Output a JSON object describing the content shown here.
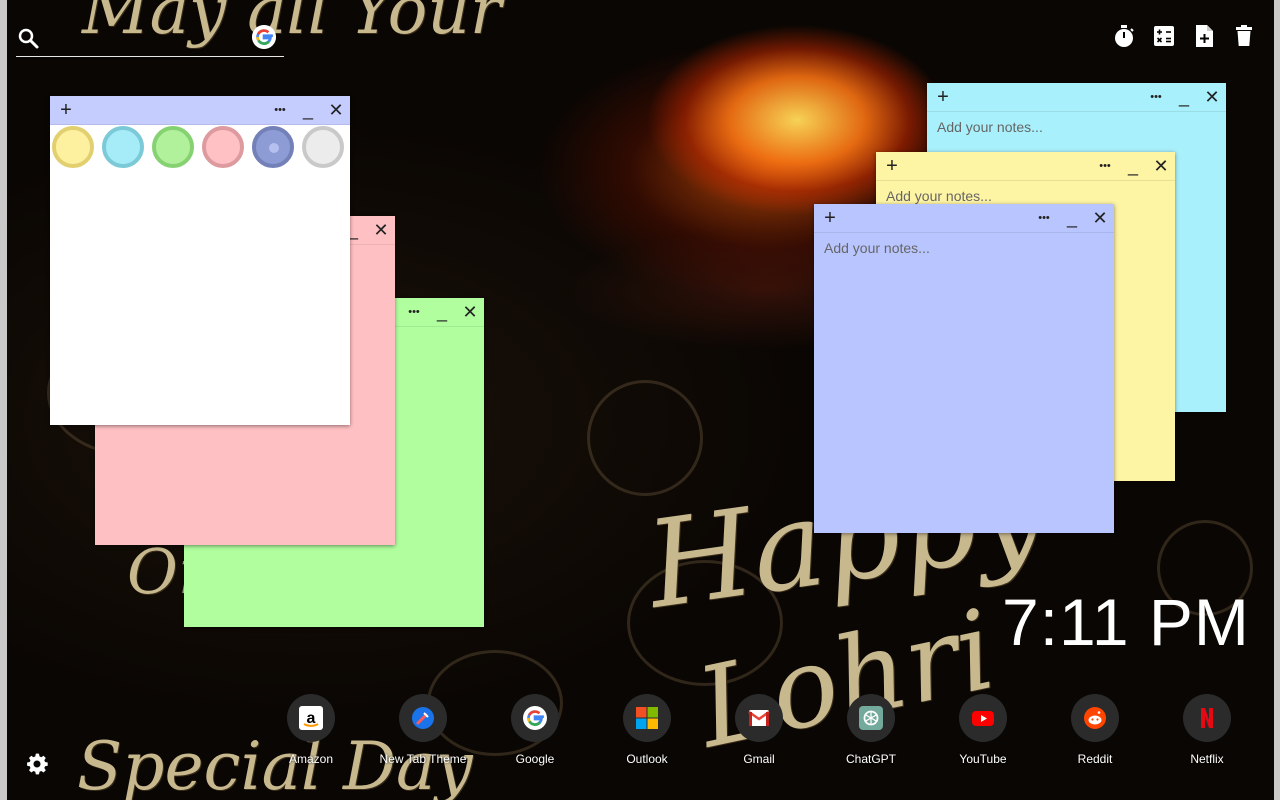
{
  "background": {
    "greeting_top": "May all Your",
    "greeting_mid_left": "On",
    "greeting_main": "Happy",
    "greeting_sub": "Lohri",
    "greeting_bottom": "Special Day"
  },
  "search": {
    "placeholder": "",
    "value": ""
  },
  "toolbar": {
    "icons": [
      "timer-icon",
      "calculator-icon",
      "new-note-icon",
      "trash-icon"
    ]
  },
  "notes": [
    {
      "color": "#ffffff",
      "header_color": "#c5cdff",
      "text": "",
      "swatches": [
        "#fdf1a0",
        "#a6ecf8",
        "#b2f19c",
        "#ffc1c4",
        "#8e9cd6",
        "#ececec"
      ],
      "swatch_rims": [
        "#e2d070",
        "#7cc9d7",
        "#86d273",
        "#dd9ba0",
        "#7381b8",
        "#c9c9c9"
      ]
    },
    {
      "color": "#ffc0c3",
      "text": ""
    },
    {
      "color": "#b0fe9e",
      "text": ""
    },
    {
      "color": "#a8f0fb",
      "text": "Add your notes..."
    },
    {
      "color": "#fdf4a4",
      "text": "Add your notes..."
    },
    {
      "color": "#b9c5ff",
      "text": "Add your notes..."
    }
  ],
  "note_controls": {
    "add": "+",
    "menu": "•••",
    "minimize": "_",
    "close": "✕"
  },
  "clock": "7:11 PM",
  "shortcuts": [
    {
      "label": "Amazon",
      "icon": "amazon-icon"
    },
    {
      "label": "New Tab Theme",
      "icon": "new-tab-theme-icon"
    },
    {
      "label": "Google",
      "icon": "google-icon"
    },
    {
      "label": "Outlook",
      "icon": "outlook-icon"
    },
    {
      "label": "Gmail",
      "icon": "gmail-icon"
    },
    {
      "label": "ChatGPT",
      "icon": "chatgpt-icon"
    },
    {
      "label": "YouTube",
      "icon": "youtube-icon"
    },
    {
      "label": "Reddit",
      "icon": "reddit-icon"
    },
    {
      "label": "Netflix",
      "icon": "netflix-icon"
    }
  ],
  "settings_icon": "gear-icon"
}
